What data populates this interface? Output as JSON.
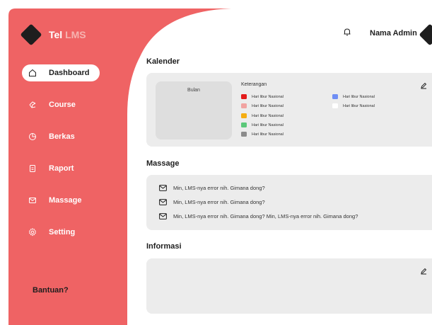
{
  "app": {
    "brand_name": "Tel",
    "brand_accent": "LMS",
    "colors": {
      "sidebar": "#ef6364",
      "card": "#ececec",
      "text": "#1e1e1e"
    }
  },
  "sidebar": {
    "items": [
      {
        "label": "Dashboard",
        "icon": "home-icon",
        "active": true
      },
      {
        "label": "Course",
        "icon": "course-icon",
        "active": false
      },
      {
        "label": "Berkas",
        "icon": "pie-chart-icon",
        "active": false
      },
      {
        "label": "Raport",
        "icon": "document-icon",
        "active": false
      },
      {
        "label": "Massage",
        "icon": "mail-icon",
        "active": false
      },
      {
        "label": "Setting",
        "icon": "gear-icon",
        "active": false
      }
    ],
    "help_label": "Bantuan?"
  },
  "header": {
    "user_name": "Nama Admin"
  },
  "calendar": {
    "title": "Kalender",
    "month_label": "Bulan",
    "legend_title": "Keterangan",
    "legend": [
      {
        "label": "Hari libur Nasional",
        "color": "#e31b1b"
      },
      {
        "label": "Hari libur Nasional",
        "color": "#f1a3a1"
      },
      {
        "label": "Hari libur Nasional",
        "color": "#f5ad12"
      },
      {
        "label": "Hari libur Nasional",
        "color": "#5cc87a"
      },
      {
        "label": "Hari libur Nasional",
        "color": "#8c8c8c"
      },
      {
        "label": "Hari libur Nasional",
        "color": "#6f8ef5"
      },
      {
        "label": "Hari libur Nasional",
        "color": "#ffffff"
      }
    ]
  },
  "messages": {
    "title": "Massage",
    "items": [
      "Min, LMS-nya error nih. Gimana dong?",
      "Min, LMS-nya error nih. Gimana dong?",
      "Min, LMS-nya error nih. Gimana dong? Min, LMS-nya error nih. Gimana dong?"
    ]
  },
  "info": {
    "title": "Informasi"
  }
}
